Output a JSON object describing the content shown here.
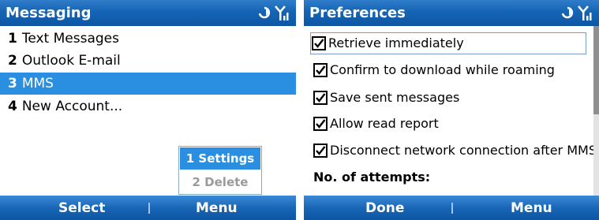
{
  "left": {
    "title": "Messaging",
    "items": [
      {
        "num": "1",
        "label": "Text Messages"
      },
      {
        "num": "2",
        "label": "Outlook E-mail"
      },
      {
        "num": "3",
        "label": "MMS"
      },
      {
        "num": "4",
        "label": "New Account..."
      }
    ],
    "selected_index": 3,
    "popup": {
      "item1": "1 Settings",
      "item2": "2 Delete"
    },
    "softkeys": {
      "left": "Select",
      "right": "Menu"
    }
  },
  "right": {
    "title": "Preferences",
    "prefs": [
      {
        "label": "Retrieve immediately",
        "checked": true
      },
      {
        "label": "Confirm to download while roaming",
        "checked": true
      },
      {
        "label": "Save sent messages",
        "checked": true
      },
      {
        "label": "Allow read report",
        "checked": true
      },
      {
        "label": "Disconnect network connection after MMS",
        "checked": true
      }
    ],
    "attempts_label": "No. of attempts:",
    "softkeys": {
      "left": "Done",
      "right": "Menu"
    }
  },
  "icons": {
    "status_left": [
      "data-connection-icon",
      "signal-strength-icon"
    ]
  },
  "colors": {
    "titlebar": "#1565b5",
    "highlight": "#2a8fe0",
    "softkey_bar": "#1966b6"
  }
}
